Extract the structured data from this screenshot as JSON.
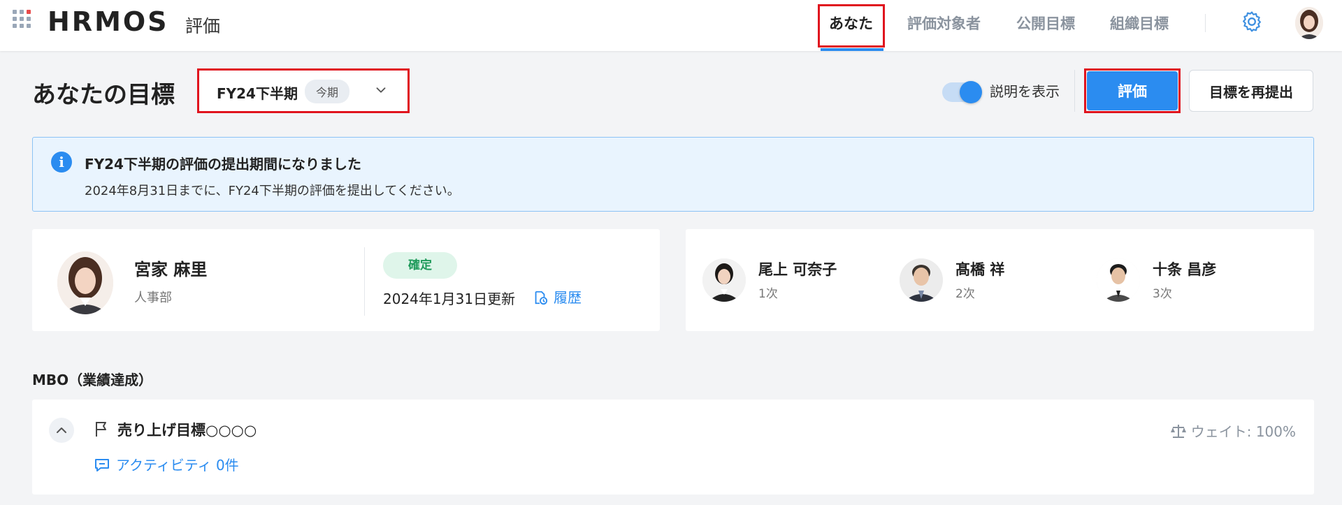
{
  "header": {
    "logo": "HRMOS",
    "logo_sub": "評価",
    "tabs": [
      {
        "label": "あなた",
        "active": true
      },
      {
        "label": "評価対象者",
        "active": false
      },
      {
        "label": "公開目標",
        "active": false
      },
      {
        "label": "組織目標",
        "active": false
      }
    ],
    "icons": [
      "apps-grid-icon",
      "gear-icon",
      "user-avatar"
    ]
  },
  "page": {
    "title": "あなたの目標",
    "period": {
      "label": "FY24下半期",
      "badge": "今期"
    },
    "toggle": {
      "label": "説明を表示",
      "on": true
    },
    "evaluate_button": "評価",
    "resubmit_button": "目標を再提出"
  },
  "banner": {
    "title": "FY24下半期の評価の提出期間になりました",
    "text": "2024年8月31日までに、FY24下半期の評価を提出してください。"
  },
  "profile": {
    "name": "宮家 麻里",
    "department": "人事部",
    "status": "確定",
    "updated": "2024年1月31日更新",
    "history_link": "履歴"
  },
  "evaluators": [
    {
      "name": "尾上 可奈子",
      "role": "1次"
    },
    {
      "name": "髙橋 祥",
      "role": "2次"
    },
    {
      "name": "十条 昌彦",
      "role": "3次"
    }
  ],
  "mbo": {
    "section_title": "MBO（業績達成）",
    "goal_title": "売り上げ目標○○○○",
    "weight": "ウェイト: 100%",
    "activity": "アクティビティ 0件"
  },
  "colors": {
    "accent": "#2b8cf0",
    "highlight_box": "#e0141e",
    "status_green": "#1e9a5a",
    "banner_bg": "#e9f4fe"
  }
}
